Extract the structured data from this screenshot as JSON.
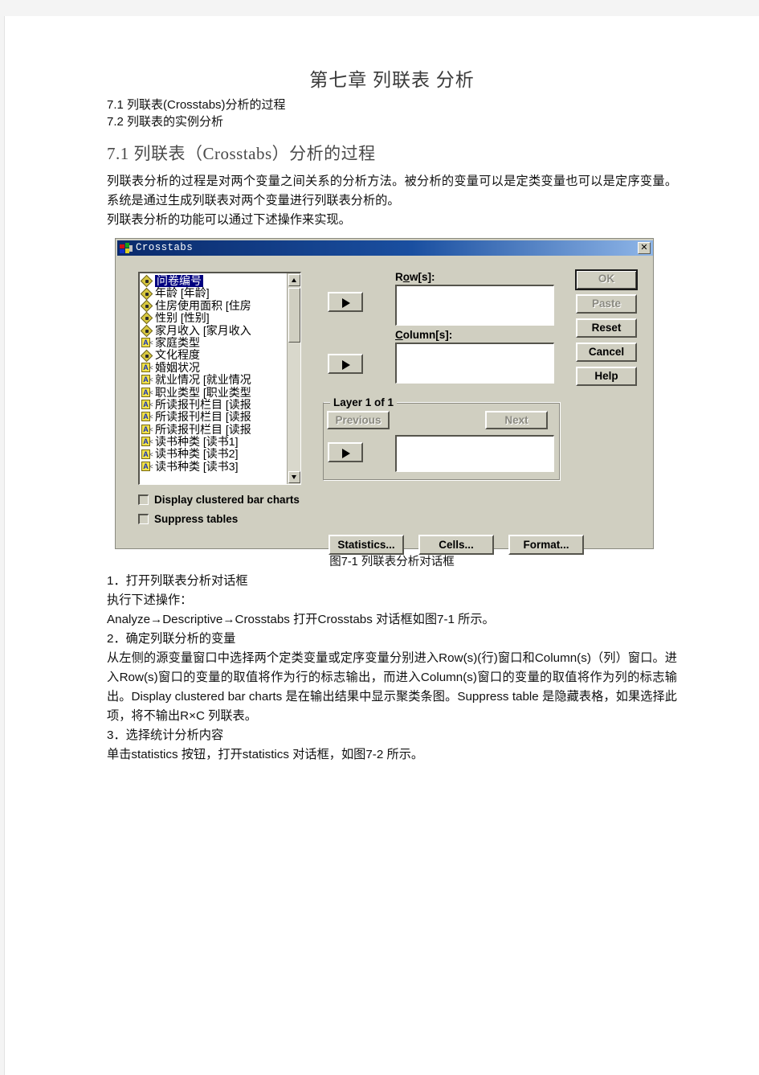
{
  "document": {
    "title": "第七章    列联表 分析",
    "toc": [
      "7.1 列联表(Crosstabs)分析的过程",
      "7.2 列联表的实例分析"
    ],
    "section_heading": "7.1 列联表（Crosstabs）分析的过程",
    "intro_paragraph": "列联表分析的过程是对两个变量之间关系的分析方法。被分析的变量可以是定类变量也可以是定序变量。系统是通过生成列联表对两个变量进行列联表分析的。",
    "intro_paragraph2": "列联表分析的功能可以通过下述操作来实现。",
    "figure_caption": "图7-1 列联表分析对话框",
    "step1_heading": "1．打开列联表分析对话框",
    "step1_line1": "执行下述操作：",
    "step1_line2": "Analyze→Descriptive→Crosstabs 打开Crosstabs 对话框如图7-1 所示。",
    "step2_heading": "2．确定列联分析的变量",
    "step2_body": "从左侧的源变量窗口中选择两个定类变量或定序变量分别进入Row(s)(行)窗口和Column(s)（列）窗口。进入Row(s)窗口的变量的取值将作为行的标志输出，而进入Column(s)窗口的变量的取值将作为列的标志输出。Display clustered bar charts 是在输出结果中显示聚类条图。Suppress table 是隐藏表格，如果选择此项，将不输出R×C 列联表。",
    "step3_heading": "3．选择统计分析内容",
    "step3_body": "单击statistics 按钮，打开statistics 对话框，如图7-2 所示。"
  },
  "dialog": {
    "title": "Crosstabs",
    "close_label": "✕",
    "variables": [
      {
        "label": "问卷编号",
        "type": "numeric",
        "selected": true
      },
      {
        "label": "年龄 [年龄]",
        "type": "numeric",
        "selected": false
      },
      {
        "label": "住房使用面积 [住房",
        "type": "numeric",
        "selected": false
      },
      {
        "label": "性别 [性别]",
        "type": "numeric",
        "selected": false
      },
      {
        "label": "家月收入 [家月收入",
        "type": "numeric",
        "selected": false
      },
      {
        "label": "家庭类型",
        "type": "string",
        "selected": false
      },
      {
        "label": "文化程度",
        "type": "numeric",
        "selected": false
      },
      {
        "label": "婚姻状况",
        "type": "string",
        "selected": false
      },
      {
        "label": "就业情况 [就业情况",
        "type": "string",
        "selected": false
      },
      {
        "label": "职业类型 [职业类型",
        "type": "string",
        "selected": false
      },
      {
        "label": "所读报刊栏目 [读报",
        "type": "string",
        "selected": false
      },
      {
        "label": "所读报刊栏目 [读报",
        "type": "string",
        "selected": false
      },
      {
        "label": "所读报刊栏目 [读报",
        "type": "string",
        "selected": false
      },
      {
        "label": "读书种类 [读书1]",
        "type": "string",
        "selected": false
      },
      {
        "label": "读书种类 [读书2]",
        "type": "string",
        "selected": false
      },
      {
        "label": "读书种类 [读书3]",
        "type": "string",
        "selected": false
      }
    ],
    "row_label_pre": "R",
    "row_label_key": "o",
    "row_label_post": "w[s]:",
    "column_label_key": "C",
    "column_label_post": "olumn[s]:",
    "row_value": "",
    "column_value": "",
    "layer_value": "",
    "layer_group_title": "Layer 1 of 1",
    "previous_label": "Previous",
    "next_label": "Next",
    "buttons": {
      "ok": "OK",
      "paste": "Paste",
      "reset": "Reset",
      "cancel": "Cancel",
      "help": "Help"
    },
    "checkboxes": [
      {
        "label": "Display clustered bar charts",
        "checked": false
      },
      {
        "label": "Suppress tables",
        "checked": false
      }
    ],
    "bottom_buttons": {
      "statistics": "Statistics...",
      "cells": "Cells...",
      "format": "Format..."
    }
  },
  "colors": {
    "dialog_face": "#d0cfc1",
    "titlebar_dark": "#0a2a6b",
    "titlebar_light": "#8fb6e8",
    "selection": "#000080",
    "page": "#ffffff"
  }
}
